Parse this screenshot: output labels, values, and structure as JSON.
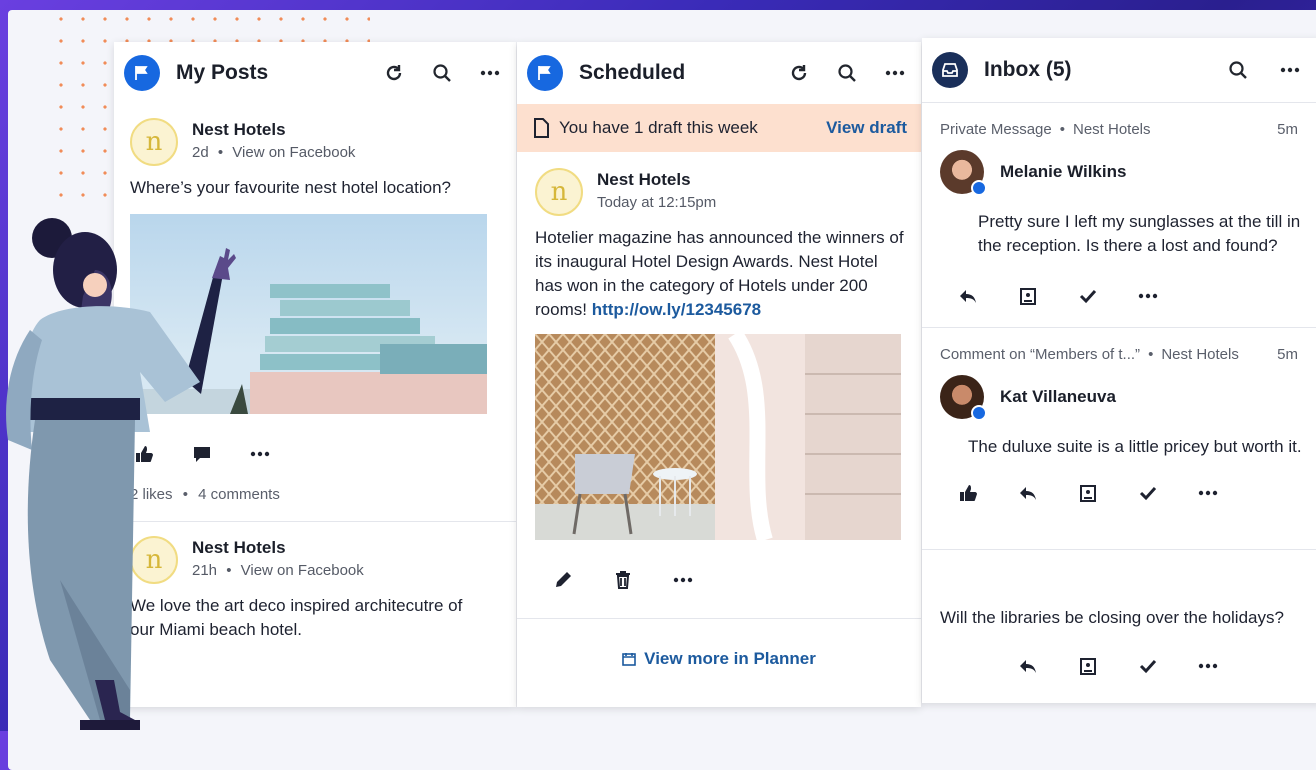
{
  "colors": {
    "accent": "#1768e0",
    "link": "#1c5a9e",
    "banner": "#fde0cf",
    "bg_purple": "#3a2bb8",
    "dots": "#f07a3c"
  },
  "my_posts": {
    "title": "My Posts",
    "posts": [
      {
        "author": "Nest Hotels",
        "age": "2d",
        "sep": "•",
        "source_link": "View on Facebook",
        "text": "Where’s your favourite nest hotel location?",
        "likes": "2 likes",
        "comments": "4 comments",
        "dot": "•"
      },
      {
        "author": "Nest Hotels",
        "age": "21h",
        "sep": "•",
        "source_link": "View on Facebook",
        "text": "We love the art deco inspired architecutre of our Miami beach hotel."
      }
    ]
  },
  "scheduled": {
    "title": "Scheduled",
    "banner_text": "You have 1 draft this week",
    "banner_link": "View draft",
    "post": {
      "author": "Nest Hotels",
      "time": "Today at 12:15pm",
      "text": "Hotelier magazine has announced the winners of its inaugural Hotel Design Awards. Nest Hotel has won in the category of Hotels under 200 rooms! ",
      "link": "http://ow.ly/12345678"
    },
    "view_more": "View more in Planner"
  },
  "inbox": {
    "title": "Inbox (5)",
    "items": [
      {
        "type": "Private Message",
        "dot": "•",
        "account": "Nest Hotels",
        "time": "5m",
        "name": "Melanie Wilkins",
        "text": "Pretty sure I left my sunglasses at the till in the reception. Is there a lost and found?"
      },
      {
        "type": "Comment on “Members of t...”",
        "dot": "•",
        "account": "Nest Hotels",
        "time": "5m",
        "name": "Kat Villaneuva",
        "text": "The duluxe suite is a little pricey but worth it."
      },
      {
        "text": "Will the libraries be closing over the holidays?"
      }
    ]
  },
  "icons": {
    "refresh": "refresh-icon",
    "search": "search-icon",
    "more": "more-icon",
    "flag": "flag-icon",
    "inbox": "inbox-icon"
  }
}
